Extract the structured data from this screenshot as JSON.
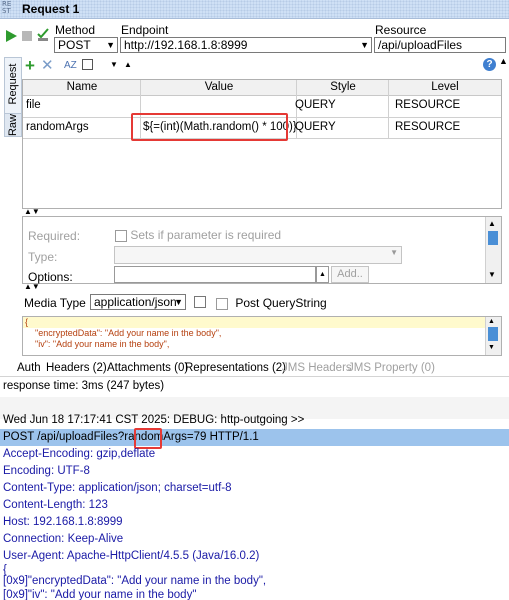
{
  "window": {
    "title": "Request 1",
    "icon_text": "RE ST"
  },
  "toolbar": {
    "method_label": "Method",
    "method_value": "POST",
    "endpoint_label": "Endpoint",
    "endpoint_value": "http://192.168.1.8:8999",
    "resource_label": "Resource",
    "resource_value": "/api/uploadFiles"
  },
  "side_tabs": {
    "request": "Request",
    "raw": "Raw"
  },
  "params": {
    "columns": [
      "Name",
      "Value",
      "Style",
      "Level"
    ],
    "rows": [
      {
        "name": "file",
        "value": "",
        "style": "QUERY",
        "level": "RESOURCE"
      },
      {
        "name": "randomArgs",
        "value": "${=(int)(Math.random() * 100)}",
        "style": "QUERY",
        "level": "RESOURCE"
      }
    ]
  },
  "param_detail": {
    "required_label": "Required:",
    "required_check": "Sets if parameter is required",
    "type_label": "Type:",
    "options_label": "Options:",
    "add_button": "Add.."
  },
  "media": {
    "label": "Media Type",
    "value": "application/json",
    "post_qs": "Post QueryString",
    "body_lines": [
      "{",
      "\"encryptedData\": \"Add your name in the body\",",
      "\"iv\": \"Add your name in the body\","
    ]
  },
  "tabs": {
    "auth": "Auth",
    "headers": "Headers (2)",
    "attachments": "Attachments (0)",
    "representations": "Representations (2)",
    "jms_headers": "JMS Headers",
    "jms_property": "JMS Property (0)"
  },
  "status": {
    "text": "response time: 3ms (247 bytes)"
  },
  "log": {
    "debug": "Wed Jun 18 17:17:41 CST 2025: DEBUG: http-outgoing >>",
    "request_line": "POST /api/uploadFiles?randomArgs=79 HTTP/1.1",
    "headers": [
      "Accept-Encoding: gzip,deflate",
      "Encoding: UTF-8",
      "Content-Type: application/json; charset=utf-8",
      "Content-Length: 123",
      "Host: 192.168.1.8:8999",
      "Connection: Keep-Alive",
      "User-Agent: Apache-HttpClient/4.5.5 (Java/16.0.2)"
    ],
    "body": [
      "{",
      "[0x9]\"encryptedData\": \"Add your name in the body\",",
      "[0x9]\"iv\": \"Add your name in the body\""
    ]
  },
  "colors": {
    "highlight": "#9cc3ec",
    "accent_red": "#e53935",
    "header_text": "#1a1aa6"
  }
}
